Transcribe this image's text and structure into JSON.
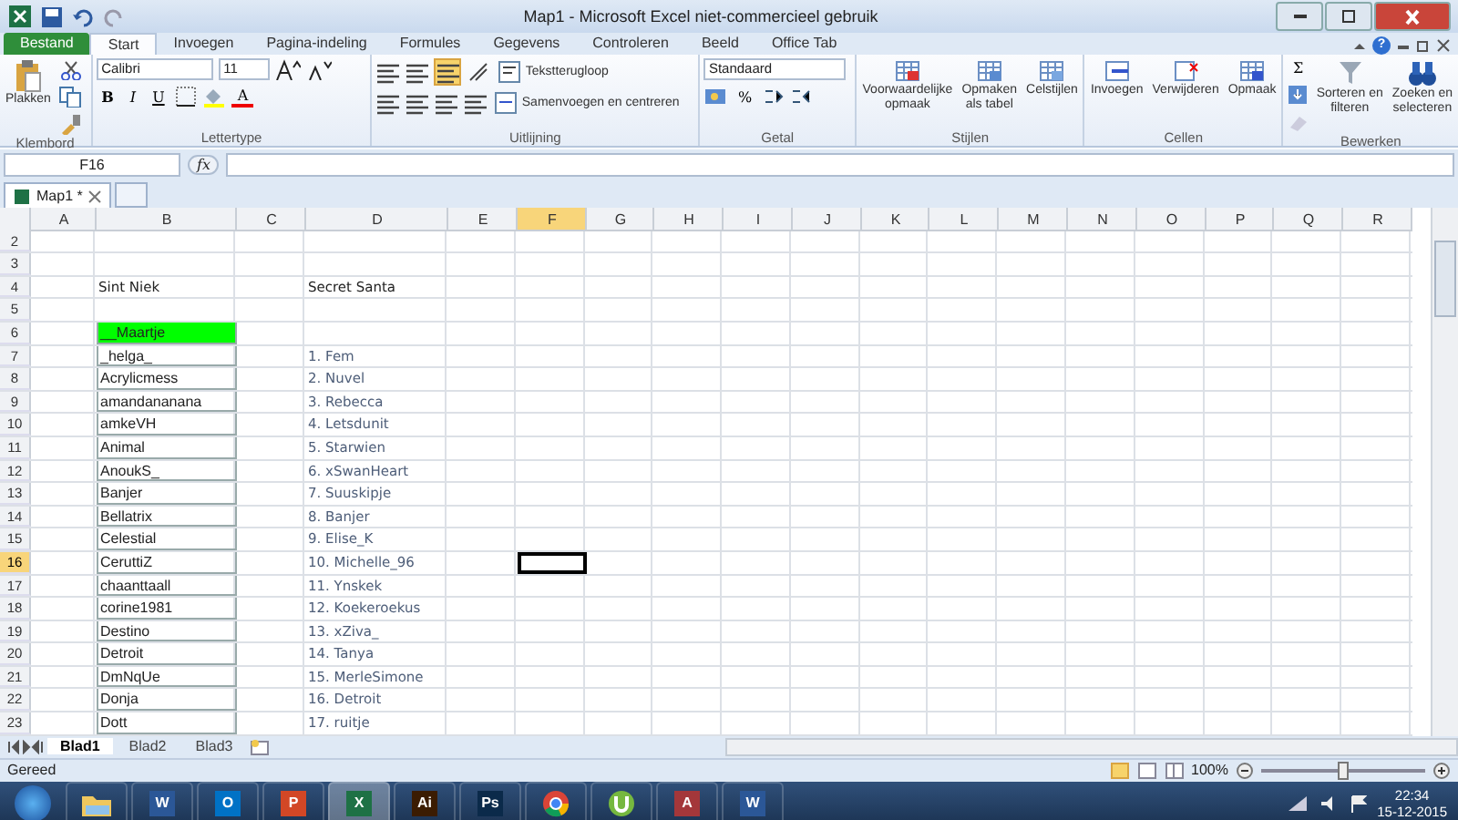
{
  "window": {
    "title": "Map1 - Microsoft Excel niet-commercieel gebruik"
  },
  "ribbon_tabs": [
    {
      "label": "Bestand",
      "kind": "file",
      "selected": false
    },
    {
      "label": "Start",
      "kind": "tab",
      "selected": true
    },
    {
      "label": "Invoegen",
      "kind": "tab",
      "selected": false
    },
    {
      "label": "Pagina-indeling",
      "kind": "tab",
      "selected": false
    },
    {
      "label": "Formules",
      "kind": "tab",
      "selected": false
    },
    {
      "label": "Gegevens",
      "kind": "tab",
      "selected": false
    },
    {
      "label": "Controleren",
      "kind": "tab",
      "selected": false
    },
    {
      "label": "Beeld",
      "kind": "tab",
      "selected": false
    },
    {
      "label": "Office Tab",
      "kind": "tab",
      "selected": false
    }
  ],
  "ribbon": {
    "paste": "Plakken",
    "font": "Calibri",
    "font_size": "11",
    "bold": "B",
    "italic": "I",
    "underline": "U",
    "font_color": "A",
    "wrap_text": "Tekstterugloop",
    "merge": "Samenvoegen en centreren",
    "number_format": "Standaard",
    "percent": "%",
    "conditional": [
      "Voorwaardelijke",
      "opmaak"
    ],
    "format_table": [
      "Opmaken",
      "als tabel"
    ],
    "cell_styles": "Celstijlen",
    "insert": "Invoegen",
    "delete": "Verwijderen",
    "format": "Opmaak",
    "sum": "Σ",
    "sort": [
      "Sorteren en",
      "filteren"
    ],
    "find": [
      "Zoeken en",
      "selecteren"
    ],
    "help": "?",
    "groups": [
      "Klembord",
      "Lettertype",
      "Uitlijning",
      "Getal",
      "Stijlen",
      "Cellen",
      "Bewerken"
    ]
  },
  "formula_bar": {
    "name_box": "F16",
    "fx": "fx"
  },
  "document_tabs": [
    {
      "label": "Map1 *",
      "selected": true
    }
  ],
  "columns": [
    {
      "label": "A",
      "selected": false
    },
    {
      "label": "B",
      "selected": false
    },
    {
      "label": "C",
      "selected": false
    },
    {
      "label": "D",
      "selected": false
    },
    {
      "label": "E",
      "selected": false
    },
    {
      "label": "F",
      "selected": true
    },
    {
      "label": "G",
      "selected": false
    },
    {
      "label": "H",
      "selected": false
    },
    {
      "label": "I",
      "selected": false
    },
    {
      "label": "J",
      "selected": false
    },
    {
      "label": "K",
      "selected": false
    },
    {
      "label": "L",
      "selected": false
    },
    {
      "label": "M",
      "selected": false
    },
    {
      "label": "N",
      "selected": false
    },
    {
      "label": "O",
      "selected": false
    },
    {
      "label": "P",
      "selected": false
    },
    {
      "label": "Q",
      "selected": false
    },
    {
      "label": "R",
      "selected": false
    }
  ],
  "rows": [
    {
      "number": "2",
      "selected": false
    },
    {
      "number": "3",
      "selected": false
    },
    {
      "number": "4",
      "selected": false,
      "column_b": {
        "text": "Sint Niek",
        "kind": "text"
      },
      "column_d": {
        "text": "Secret Santa",
        "kind": "text"
      }
    },
    {
      "number": "5",
      "selected": false
    },
    {
      "number": "6",
      "selected": false,
      "column_b": {
        "text": "__Maartje",
        "kind": "boxed",
        "color": "#00ff00"
      }
    },
    {
      "number": "7",
      "selected": false,
      "column_b": {
        "text": "_helga_",
        "kind": "boxed"
      },
      "column_d": {
        "text": "1. Fem",
        "kind": "entry"
      }
    },
    {
      "number": "8",
      "selected": false,
      "column_b": {
        "text": "Acrylicmess",
        "kind": "boxed"
      },
      "column_d": {
        "text": "2. Nuvel",
        "kind": "entry"
      }
    },
    {
      "number": "9",
      "selected": false,
      "column_b": {
        "text": "amandananana",
        "kind": "boxed"
      },
      "column_d": {
        "text": "3. Rebecca",
        "kind": "entry"
      }
    },
    {
      "number": "10",
      "selected": false,
      "column_b": {
        "text": "amkeVH",
        "kind": "boxed"
      },
      "column_d": {
        "text": "4. Letsdunit",
        "kind": "entry"
      }
    },
    {
      "number": "11",
      "selected": false,
      "column_b": {
        "text": "Animal",
        "kind": "boxed"
      },
      "column_d": {
        "text": "5. Starwien",
        "kind": "entry"
      }
    },
    {
      "number": "12",
      "selected": false,
      "column_b": {
        "text": "AnoukS_",
        "kind": "boxed"
      },
      "column_d": {
        "text": "6. xSwanHeart",
        "kind": "entry"
      }
    },
    {
      "number": "13",
      "selected": false,
      "column_b": {
        "text": "Banjer",
        "kind": "boxed"
      },
      "column_d": {
        "text": "7. Suuskipje",
        "kind": "entry"
      }
    },
    {
      "number": "14",
      "selected": false,
      "column_b": {
        "text": "Bellatrix",
        "kind": "boxed"
      },
      "column_d": {
        "text": "8. Banjer",
        "kind": "entry"
      }
    },
    {
      "number": "15",
      "selected": false,
      "column_b": {
        "text": "Celestial",
        "kind": "boxed"
      },
      "column_d": {
        "text": "9. Elise_K",
        "kind": "entry"
      }
    },
    {
      "number": "16",
      "selected": true,
      "column_b": {
        "text": "CeruttiZ",
        "kind": "boxed"
      },
      "column_d": {
        "text": "10. Michelle_96",
        "kind": "entry"
      }
    },
    {
      "number": "17",
      "selected": false,
      "column_b": {
        "text": "chaanttaall",
        "kind": "boxed"
      },
      "column_d": {
        "text": "11. Ynskek",
        "kind": "entry"
      }
    },
    {
      "number": "18",
      "selected": false,
      "column_b": {
        "text": "corine1981",
        "kind": "boxed"
      },
      "column_d": {
        "text": "12. Koekeroekus",
        "kind": "entry"
      }
    },
    {
      "number": "19",
      "selected": false,
      "column_b": {
        "text": "Destino",
        "kind": "boxed"
      },
      "column_d": {
        "text": "13. xZiva_",
        "kind": "entry"
      }
    },
    {
      "number": "20",
      "selected": false,
      "column_b": {
        "text": "Detroit",
        "kind": "boxed"
      },
      "column_d": {
        "text": "14. Tanya",
        "kind": "entry"
      }
    },
    {
      "number": "21",
      "selected": false,
      "column_b": {
        "text": "DmNqUe",
        "kind": "boxed"
      },
      "column_d": {
        "text": "15. MerleSimone",
        "kind": "entry"
      }
    },
    {
      "number": "22",
      "selected": false,
      "column_b": {
        "text": "Donja",
        "kind": "boxed"
      },
      "column_d": {
        "text": "16. Detroit",
        "kind": "entry"
      }
    },
    {
      "number": "23",
      "selected": false,
      "column_b": {
        "text": "Dott",
        "kind": "boxed"
      },
      "column_d": {
        "text": "17. ruitje",
        "kind": "entry"
      }
    }
  ],
  "sheet_tabs": [
    {
      "label": "Blad1",
      "selected": true
    },
    {
      "label": "Blad2",
      "selected": false
    },
    {
      "label": "Blad3",
      "selected": false
    }
  ],
  "status_bar": {
    "status": "Gereed",
    "zoom": "100%",
    "zoom_slider": {
      "level": 0.5
    }
  },
  "taskbar": {
    "items": [
      {
        "kind": "folder",
        "selected": false
      },
      {
        "kind": "app",
        "label": "W",
        "color": "#2b5797",
        "selected": false
      },
      {
        "kind": "app",
        "label": "O",
        "color": "#0072c6",
        "selected": false
      },
      {
        "kind": "app",
        "label": "P",
        "color": "#d24726",
        "selected": false
      },
      {
        "kind": "app",
        "label": "X",
        "color": "#1e7145",
        "selected": true
      },
      {
        "kind": "app",
        "label": "Ai",
        "color": "#3b1c02",
        "selected": false
      },
      {
        "kind": "app",
        "label": "Ps",
        "color": "#0b2a4a",
        "selected": false
      },
      {
        "kind": "chrome",
        "selected": false
      },
      {
        "kind": "torrent",
        "selected": false
      },
      {
        "kind": "app",
        "label": "A",
        "color": "#a4373a",
        "selected": false
      },
      {
        "kind": "app",
        "label": "W",
        "color": "#2b5797",
        "selected": false
      }
    ],
    "time": "22:34",
    "date": "15-12-2015"
  }
}
